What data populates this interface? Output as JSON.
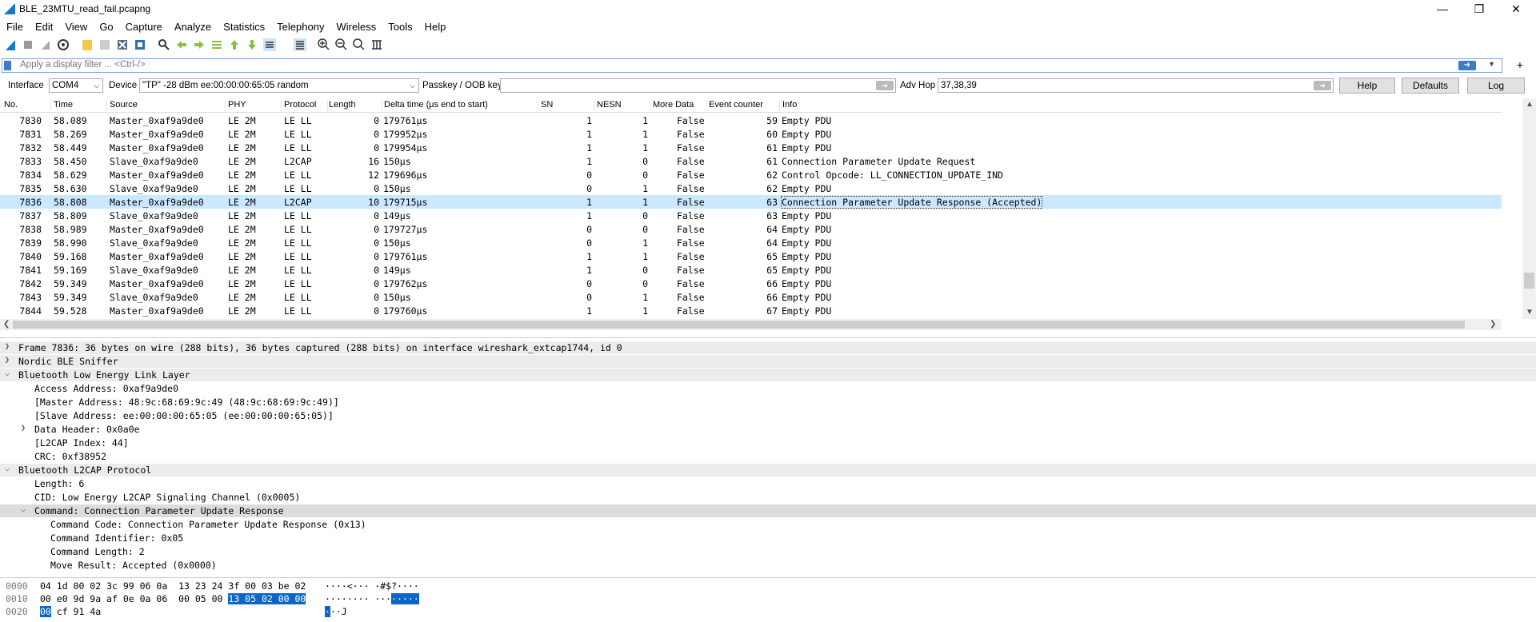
{
  "window": {
    "title": "BLE_23MTU_read_fail.pcapng"
  },
  "menu": [
    "File",
    "Edit",
    "View",
    "Go",
    "Capture",
    "Analyze",
    "Statistics",
    "Telephony",
    "Wireless",
    "Tools",
    "Help"
  ],
  "filter": {
    "placeholder": "Apply a display filter ... <Ctrl-/>"
  },
  "capture_bar": {
    "interface_label": "Interface",
    "interface_value": "COM4",
    "device_label": "Device",
    "device_value": "\"TP\" -28 dBm  ee:00:00:00:65:05  random",
    "passkey_label": "Passkey / OOB key",
    "passkey_value": "",
    "advhop_label": "Adv Hop",
    "advhop_value": "37,38,39",
    "help_label": "Help",
    "defaults_label": "Defaults",
    "log_label": "Log"
  },
  "packet_list": {
    "columns": [
      "No.",
      "Time",
      "Source",
      "PHY",
      "Protocol",
      "Length",
      "Delta time (µs end to start)",
      "SN",
      "NESN",
      "More Data",
      "Event counter",
      "Info"
    ],
    "rows": [
      {
        "no": "7830",
        "time": "58.089",
        "src": "Master_0xaf9a9de0",
        "phy": "LE 2M",
        "proto": "LE LL",
        "len": "0",
        "delta": "179761µs",
        "sn": "1",
        "nesn": "1",
        "more": "False",
        "ev": "59",
        "info": "Empty PDU"
      },
      {
        "no": "7831",
        "time": "58.269",
        "src": "Master_0xaf9a9de0",
        "phy": "LE 2M",
        "proto": "LE LL",
        "len": "0",
        "delta": "179952µs",
        "sn": "1",
        "nesn": "1",
        "more": "False",
        "ev": "60",
        "info": "Empty PDU"
      },
      {
        "no": "7832",
        "time": "58.449",
        "src": "Master_0xaf9a9de0",
        "phy": "LE 2M",
        "proto": "LE LL",
        "len": "0",
        "delta": "179954µs",
        "sn": "1",
        "nesn": "1",
        "more": "False",
        "ev": "61",
        "info": "Empty PDU"
      },
      {
        "no": "7833",
        "time": "58.450",
        "src": "Slave_0xaf9a9de0",
        "phy": "LE 2M",
        "proto": "L2CAP",
        "len": "16",
        "delta": "150µs",
        "sn": "1",
        "nesn": "0",
        "more": "False",
        "ev": "61",
        "info": "Connection Parameter Update Request"
      },
      {
        "no": "7834",
        "time": "58.629",
        "src": "Master_0xaf9a9de0",
        "phy": "LE 2M",
        "proto": "LE LL",
        "len": "12",
        "delta": "179696µs",
        "sn": "0",
        "nesn": "0",
        "more": "False",
        "ev": "62",
        "info": "Control Opcode: LL_CONNECTION_UPDATE_IND"
      },
      {
        "no": "7835",
        "time": "58.630",
        "src": "Slave_0xaf9a9de0",
        "phy": "LE 2M",
        "proto": "LE LL",
        "len": "0",
        "delta": "150µs",
        "sn": "0",
        "nesn": "1",
        "more": "False",
        "ev": "62",
        "info": "Empty PDU"
      },
      {
        "no": "7836",
        "time": "58.808",
        "src": "Master_0xaf9a9de0",
        "phy": "LE 2M",
        "proto": "L2CAP",
        "len": "10",
        "delta": "179715µs",
        "sn": "1",
        "nesn": "1",
        "more": "False",
        "ev": "63",
        "info": "Connection Parameter Update Response (Accepted)",
        "selected": true
      },
      {
        "no": "7837",
        "time": "58.809",
        "src": "Slave_0xaf9a9de0",
        "phy": "LE 2M",
        "proto": "LE LL",
        "len": "0",
        "delta": "149µs",
        "sn": "1",
        "nesn": "0",
        "more": "False",
        "ev": "63",
        "info": "Empty PDU"
      },
      {
        "no": "7838",
        "time": "58.989",
        "src": "Master_0xaf9a9de0",
        "phy": "LE 2M",
        "proto": "LE LL",
        "len": "0",
        "delta": "179727µs",
        "sn": "0",
        "nesn": "0",
        "more": "False",
        "ev": "64",
        "info": "Empty PDU"
      },
      {
        "no": "7839",
        "time": "58.990",
        "src": "Slave_0xaf9a9de0",
        "phy": "LE 2M",
        "proto": "LE LL",
        "len": "0",
        "delta": "150µs",
        "sn": "0",
        "nesn": "1",
        "more": "False",
        "ev": "64",
        "info": "Empty PDU"
      },
      {
        "no": "7840",
        "time": "59.168",
        "src": "Master_0xaf9a9de0",
        "phy": "LE 2M",
        "proto": "LE LL",
        "len": "0",
        "delta": "179761µs",
        "sn": "1",
        "nesn": "1",
        "more": "False",
        "ev": "65",
        "info": "Empty PDU"
      },
      {
        "no": "7841",
        "time": "59.169",
        "src": "Slave_0xaf9a9de0",
        "phy": "LE 2M",
        "proto": "LE LL",
        "len": "0",
        "delta": "149µs",
        "sn": "1",
        "nesn": "0",
        "more": "False",
        "ev": "65",
        "info": "Empty PDU"
      },
      {
        "no": "7842",
        "time": "59.349",
        "src": "Master_0xaf9a9de0",
        "phy": "LE 2M",
        "proto": "LE LL",
        "len": "0",
        "delta": "179762µs",
        "sn": "0",
        "nesn": "0",
        "more": "False",
        "ev": "66",
        "info": "Empty PDU"
      },
      {
        "no": "7843",
        "time": "59.349",
        "src": "Slave_0xaf9a9de0",
        "phy": "LE 2M",
        "proto": "LE LL",
        "len": "0",
        "delta": "150µs",
        "sn": "0",
        "nesn": "1",
        "more": "False",
        "ev": "66",
        "info": "Empty PDU"
      },
      {
        "no": "7844",
        "time": "59.528",
        "src": "Master_0xaf9a9de0",
        "phy": "LE 2M",
        "proto": "LE LL",
        "len": "0",
        "delta": "179760µs",
        "sn": "1",
        "nesn": "1",
        "more": "False",
        "ev": "67",
        "info": "Empty PDU"
      }
    ]
  },
  "details": [
    {
      "text": "Frame 7836: 36 bytes on wire (288 bits), 36 bytes captured (288 bits) on interface wireshark_extcap1744, id 0",
      "level": 0,
      "toggle": "collapsed"
    },
    {
      "text": "Nordic BLE Sniffer",
      "level": 0,
      "toggle": "collapsed"
    },
    {
      "text": "Bluetooth Low Energy Link Layer",
      "level": 0,
      "toggle": "expanded"
    },
    {
      "text": "Access Address: 0xaf9a9de0",
      "level": 1,
      "toggle": "none"
    },
    {
      "text": "[Master Address: 48:9c:68:69:9c:49 (48:9c:68:69:9c:49)]",
      "level": 1,
      "toggle": "none"
    },
    {
      "text": "[Slave Address: ee:00:00:00:65:05 (ee:00:00:00:65:05)]",
      "level": 1,
      "toggle": "none"
    },
    {
      "text": "Data Header: 0x0a0e",
      "level": 1,
      "toggle": "collapsed"
    },
    {
      "text": "[L2CAP Index: 44]",
      "level": 1,
      "toggle": "none"
    },
    {
      "text": "CRC: 0xf38952",
      "level": 1,
      "toggle": "none"
    },
    {
      "text": "Bluetooth L2CAP Protocol",
      "level": 0,
      "toggle": "expanded"
    },
    {
      "text": "Length: 6",
      "level": 1,
      "toggle": "none"
    },
    {
      "text": "CID: Low Energy L2CAP Signaling Channel (0x0005)",
      "level": 1,
      "toggle": "none"
    },
    {
      "text": "Command: Connection Parameter Update Response",
      "level": 1,
      "toggle": "expanded",
      "highlight": true
    },
    {
      "text": "Command Code: Connection Parameter Update Response (0x13)",
      "level": 2,
      "toggle": "none"
    },
    {
      "text": "Command Identifier: 0x05",
      "level": 2,
      "toggle": "none"
    },
    {
      "text": "Command Length: 2",
      "level": 2,
      "toggle": "none"
    },
    {
      "text": "Move Result: Accepted (0x0000)",
      "level": 2,
      "toggle": "none"
    }
  ],
  "bytes": [
    {
      "offset": "0000",
      "hex_a": "04 1d 00 02 3c 99 06 0a  13 23 24 3f 00 03 be 02",
      "hex_hl": "",
      "hex_b": "",
      "ascii_a": "····<··· ·#$?····",
      "ascii_hl": "",
      "ascii_b": ""
    },
    {
      "offset": "0010",
      "hex_a": "00 e0 9d 9a af 0e 0a 06  00 05 00 ",
      "hex_hl": "13 05 02 00 00",
      "hex_b": "",
      "ascii_a": "········ ···",
      "ascii_hl": "·····",
      "ascii_b": ""
    },
    {
      "offset": "0020",
      "hex_a": "",
      "hex_hl": "00",
      "hex_b": " cf 91 4a",
      "ascii_a": "",
      "ascii_hl": "·",
      "ascii_b": "··J"
    }
  ]
}
